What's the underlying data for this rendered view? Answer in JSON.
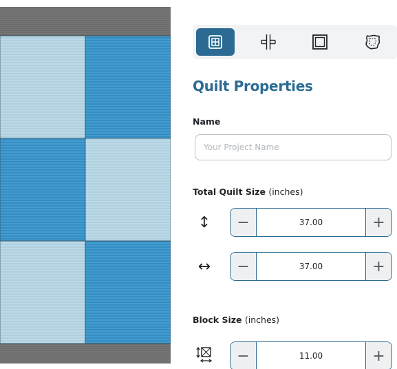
{
  "colors": {
    "accent": "#2b6b93",
    "fabric_dark": "#3592c9",
    "fabric_light": "#b5d6e6",
    "binding": "#6b6b6b"
  },
  "quilt_preview": {
    "pattern": [
      "light",
      "dark",
      "dark",
      "light",
      "light",
      "dark"
    ]
  },
  "toolbar": {
    "tools": [
      {
        "icon": "grid-block-icon",
        "active": true
      },
      {
        "icon": "sashing-cross-icon",
        "active": false
      },
      {
        "icon": "border-frame-icon",
        "active": false
      },
      {
        "icon": "applique-shape-icon",
        "active": false
      }
    ]
  },
  "panel": {
    "title": "Quilt Properties",
    "name_label": "Name",
    "name_value": "",
    "name_placeholder": "Your Project Name",
    "total_size_label": "Total Quilt Size",
    "total_size_unit": "(inches)",
    "height": {
      "icon": "vertical-arrows-icon",
      "glyph": "↕",
      "value": "37.00"
    },
    "width": {
      "icon": "horizontal-arrows-icon",
      "glyph": "↔",
      "value": "37.00"
    },
    "block_size_label": "Block Size",
    "block_size_unit": "(inches)",
    "block": {
      "icon": "block-size-icon",
      "value": "11.00"
    },
    "minus_label": "−",
    "plus_label": "+"
  }
}
